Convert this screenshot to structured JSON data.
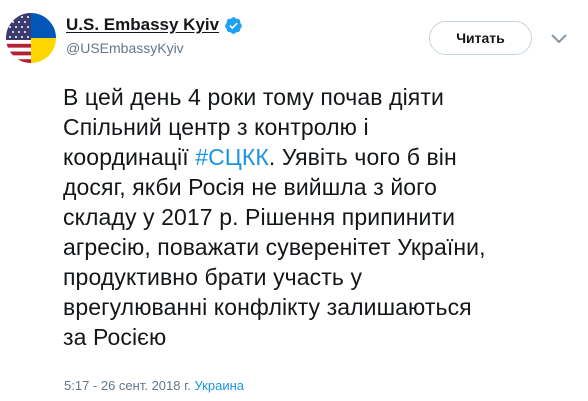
{
  "account": {
    "display_name": "U.S. Embassy Kyiv",
    "handle": "@USEmbassyKyiv",
    "verified": true,
    "avatar_icon": "us-ukraine-flag-avatar-icon",
    "verified_icon": "verified-badge-icon"
  },
  "actions": {
    "follow_label": "Читать",
    "caret_icon": "chevron-down-icon"
  },
  "tweet": {
    "lines": [
      {
        "before": "В цей день 4 роки тому почав діяти",
        "hashtag": "",
        "after": ""
      },
      {
        "before": "Спільний центр з контролю і",
        "hashtag": "",
        "after": ""
      },
      {
        "before": "координації ",
        "hashtag": "#СЦКК",
        "after": ". Уявіть чого б він"
      },
      {
        "before": "досяг, якби Росія не вийшла з його",
        "hashtag": "",
        "after": ""
      },
      {
        "before": "складу у 2017 р. Рішення припинити",
        "hashtag": "",
        "after": ""
      },
      {
        "before": "агресію, поважати суверенітет України,",
        "hashtag": "",
        "after": ""
      },
      {
        "before": "продуктивно брати участь у",
        "hashtag": "",
        "after": ""
      },
      {
        "before": "врегулюванні конфлікту залишаються",
        "hashtag": "",
        "after": ""
      },
      {
        "before": "за Росією",
        "hashtag": "",
        "after": ""
      }
    ]
  },
  "meta": {
    "timestamp": "5:17 - 26 сент. 2018 г.",
    "location": "Украина"
  },
  "colors": {
    "link": "#1b95e0",
    "text": "#14171a",
    "secondary": "#657786",
    "verified": "#1da1f2",
    "flag_blue": "#0057b7",
    "flag_yellow": "#ffd700",
    "us_red": "#b22234",
    "us_blue": "#3c3b6e"
  }
}
